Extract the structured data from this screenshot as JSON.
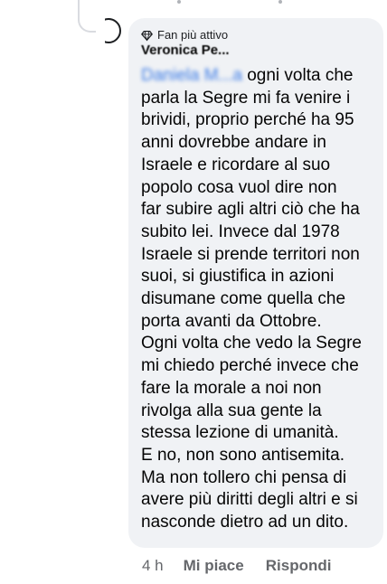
{
  "comment": {
    "badge_icon": "diamond-badge-icon",
    "badge_label": "Fan più attivo",
    "author_name": "Veronica Pe...",
    "mention": "Daniela M...a",
    "lines": [
      " ogni volta che",
      "parla la Segre mi fa venire i",
      "brividi, proprio perché ha 95",
      "anni dovrebbe andare in",
      "Israele e ricordare al suo",
      "popolo cosa vuol dire non",
      "far subire agli altri ciò che ha",
      "subito lei. Invece dal 1978",
      "Israele si prende territori non",
      "suoi, si giustifica in azioni",
      "disumane come quella che",
      "porta avanti da Ottobre.",
      "Ogni volta che vedo la Segre",
      "mi chiedo perché invece che",
      "fare la morale a noi non",
      "rivolga alla sua gente la",
      "stessa lezione di umanità.",
      "E no, non sono antisemita.",
      "Ma non tollero chi pensa di",
      "avere più diritti degli altri e si",
      "nasconde dietro ad un dito."
    ],
    "bubble_color": "#f0f2f5",
    "mention_color": "#3b7be6"
  },
  "actions": {
    "time": "4 h",
    "like_label": "Mi piace",
    "reply_label": "Rispondi"
  }
}
